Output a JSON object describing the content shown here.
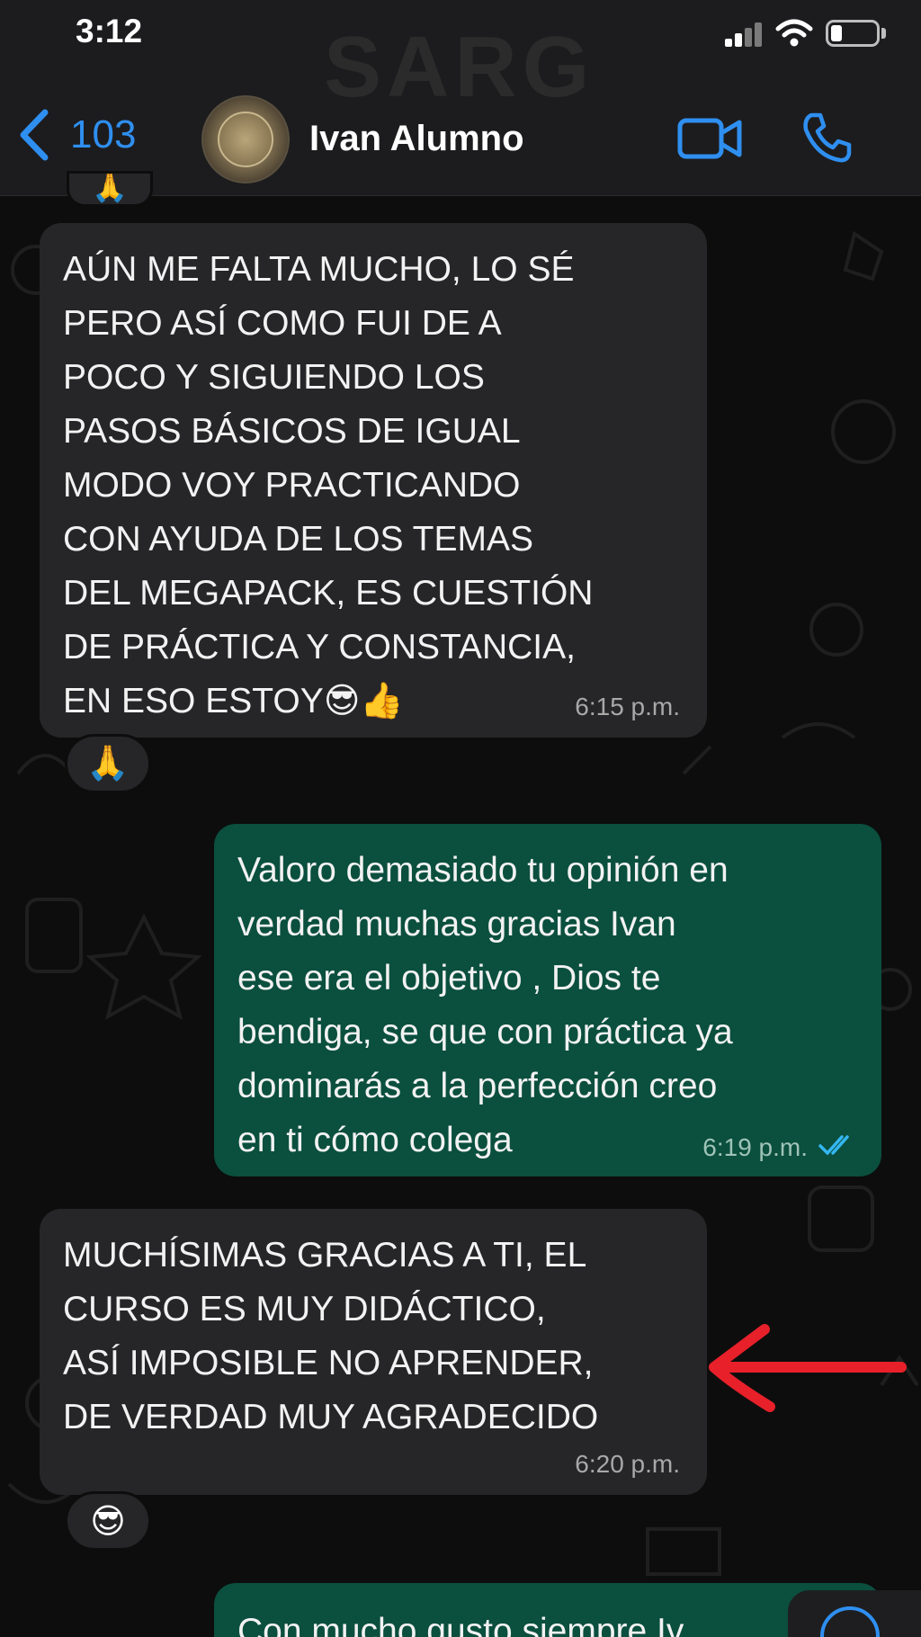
{
  "status_bar": {
    "time": "3:12",
    "watermark": "SARG"
  },
  "header": {
    "back_count": "103",
    "contact_name": "Ivan Alumno",
    "accent_color": "#2f8ff0"
  },
  "messages": [
    {
      "direction": "incoming",
      "text": "AÚN ME FALTA MUCHO, LO SÉ\nPERO ASÍ COMO FUI DE A\nPOCO Y SIGUIENDO LOS\nPASOS BÁSICOS DE IGUAL\nMODO VOY PRACTICANDO\nCON AYUDA DE LOS TEMAS\nDEL MEGAPACK, ES CUESTIÓN\nDE PRÁCTICA Y CONSTANCIA,\nEN ESO ESTOY😎👍",
      "time": "6:15 p.m.",
      "reaction": "🙏"
    },
    {
      "direction": "outgoing",
      "text": "Valoro demasiado tu opinión en\nverdad muchas gracias Ivan\nese era el objetivo , Dios te\nbendiga, se que con práctica ya\ndominarás a la perfección creo\nen ti cómo colega",
      "time": "6:19 p.m.",
      "status": "read"
    },
    {
      "direction": "incoming",
      "text": "MUCHÍSIMAS GRACIAS A TI, EL\nCURSO ES MUY DIDÁCTICO,\nASÍ IMPOSIBLE NO APRENDER,\nDE VERDAD MUY AGRADECIDO",
      "time": "6:20 p.m.",
      "reaction": "😎"
    },
    {
      "direction": "outgoing",
      "text": "Con mucho gusto siempre Iv"
    }
  ],
  "top_partial_reaction": "🙏",
  "colors": {
    "incoming_bubble": "#262628",
    "outgoing_bubble": "#0b4f3e",
    "annotation_arrow": "#e8202a",
    "read_tick": "#34b7f1"
  }
}
